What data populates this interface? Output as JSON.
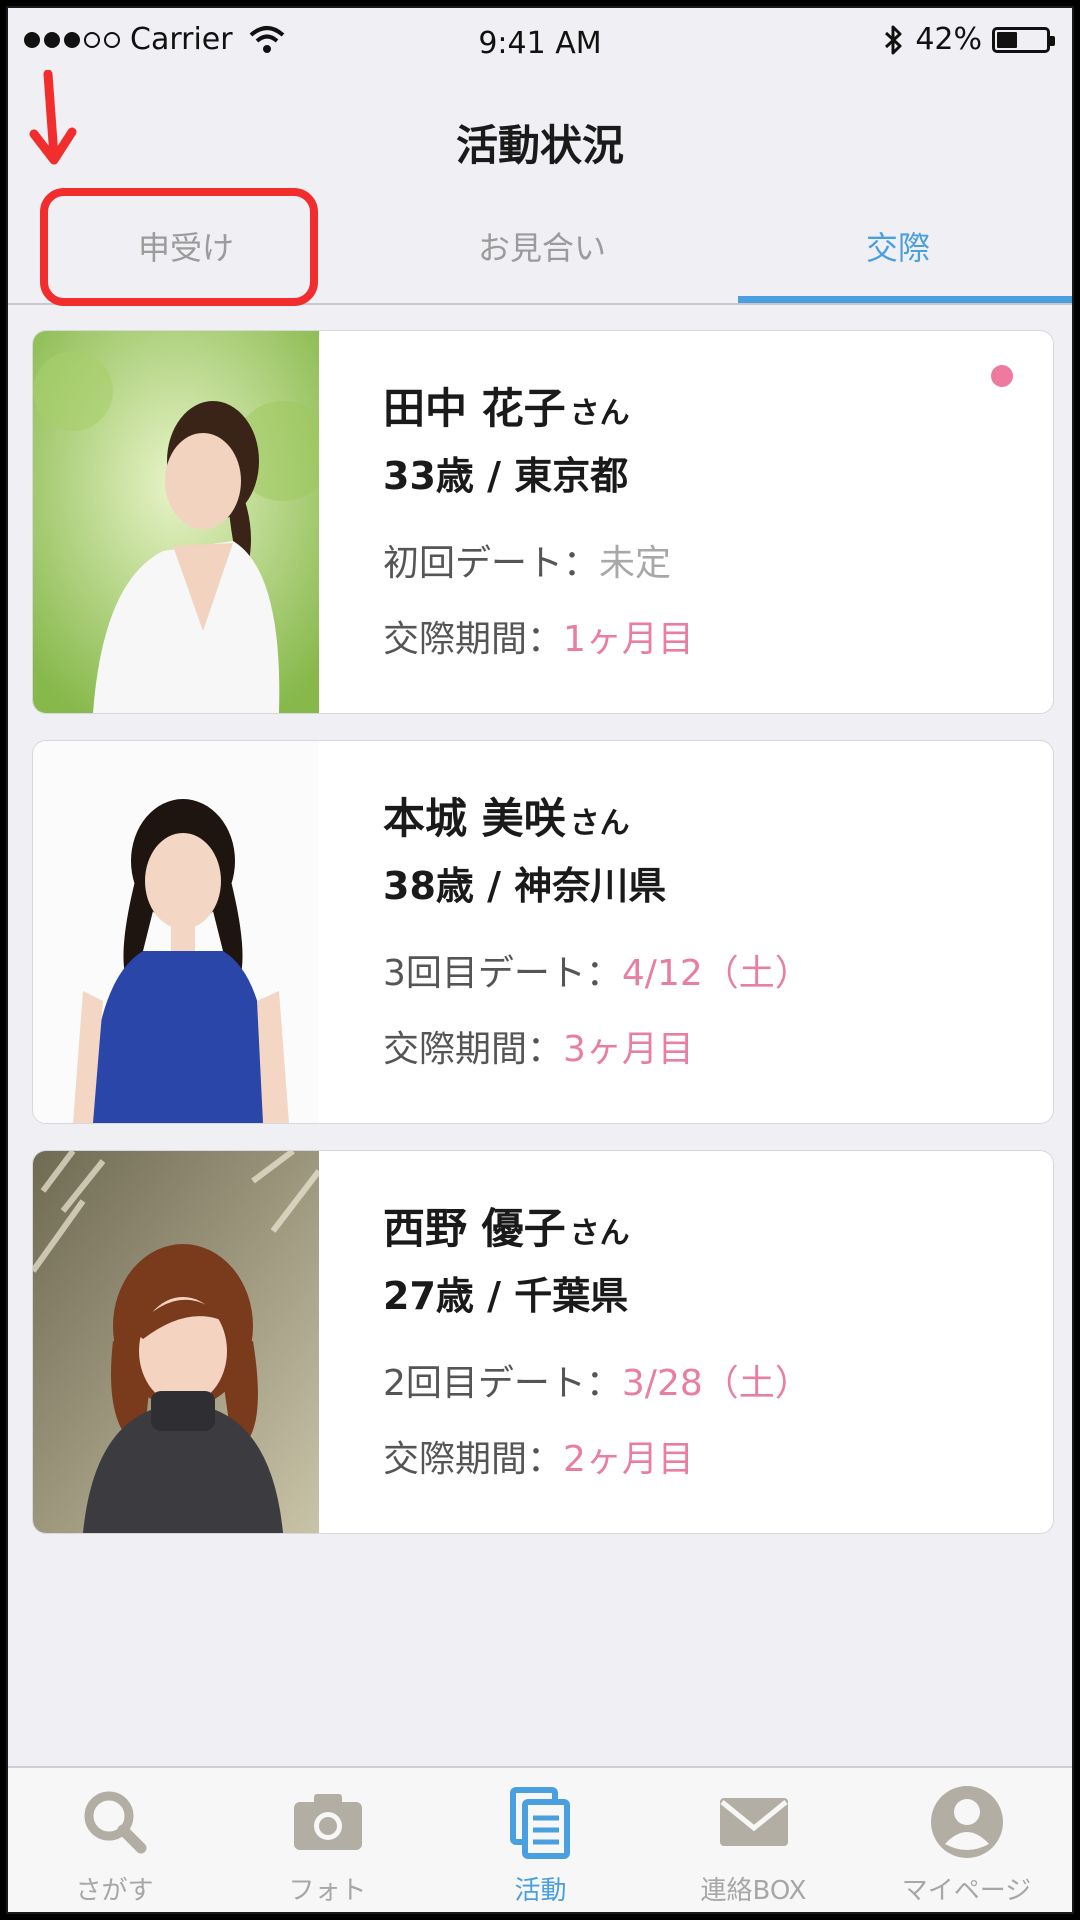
{
  "status_bar": {
    "carrier": "Carrier",
    "time": "9:41 AM",
    "battery": "42%",
    "battery_level": 0.42
  },
  "header": {
    "title": "活動状況"
  },
  "tabs": [
    {
      "label": "申受け",
      "active": false
    },
    {
      "label": "お見合い",
      "active": false
    },
    {
      "label": "交際",
      "active": true
    }
  ],
  "accent_color": "#4a9fdf",
  "highlight_color": "#e97ea3",
  "cards": [
    {
      "name": "田中 花子",
      "honorific": "さん",
      "age_location": "33歳 / 東京都",
      "date_label": "初回デート：",
      "date_value": "未定",
      "period_label": "交際期間：",
      "period_value": "1ヶ月目",
      "unread": true
    },
    {
      "name": "本城 美咲",
      "honorific": "さん",
      "age_location": "38歳 / 神奈川県",
      "date_label": "3回目デート：",
      "date_value": "4/12（土）",
      "period_label": "交際期間：",
      "period_value": "3ヶ月目",
      "unread": false
    },
    {
      "name": "西野 優子",
      "honorific": "さん",
      "age_location": "27歳 / 千葉県",
      "date_label": "2回目デート：",
      "date_value": "3/28（土）",
      "period_label": "交際期間：",
      "period_value": "2ヶ月目",
      "unread": false
    }
  ],
  "tabbar": [
    {
      "label": "さがす",
      "icon": "search-icon",
      "active": false
    },
    {
      "label": "フォト",
      "icon": "camera-icon",
      "active": false
    },
    {
      "label": "活動",
      "icon": "documents-icon",
      "active": true
    },
    {
      "label": "連絡BOX",
      "icon": "mail-icon",
      "active": false
    },
    {
      "label": "マイページ",
      "icon": "user-icon",
      "active": false
    }
  ]
}
